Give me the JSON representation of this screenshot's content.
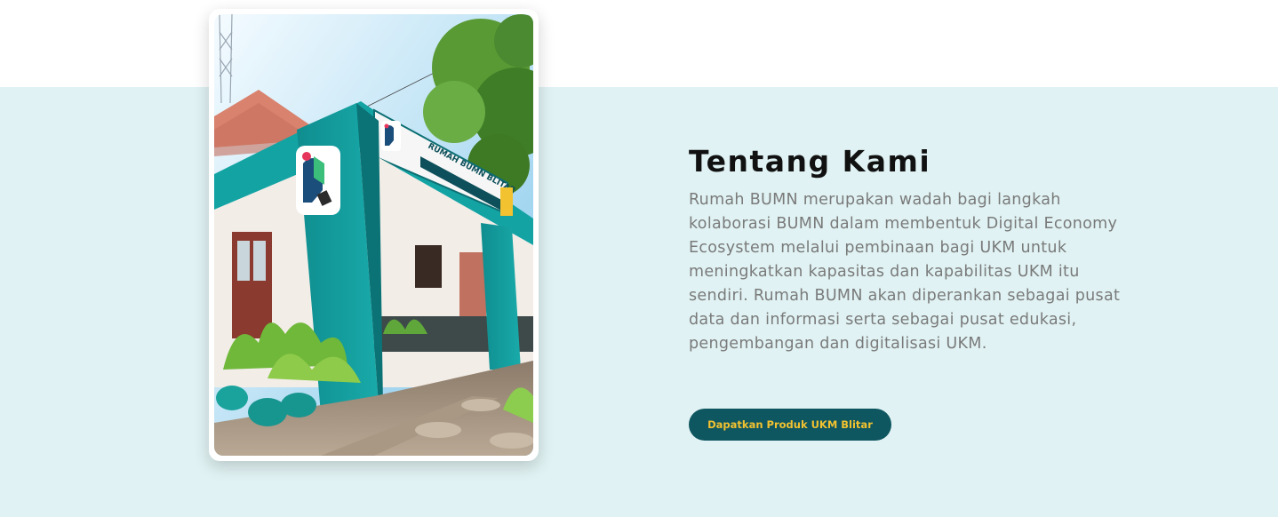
{
  "about": {
    "title": "Tentang Kami",
    "description": "Rumah BUMN merupakan wadah bagi langkah kolaborasi BUMN dalam membentuk Digital Economy Ecosystem melalui pembinaan bagi UKM untuk meningkatkan kapasitas dan kapabilitas UKM itu sendiri. Rumah BUMN akan diperankan sebagai pusat data dan informasi serta sebagai pusat edukasi, pengembangan dan digitalisasi UKM.",
    "cta_label": "Dapatkan Produk UKM Blitar",
    "photo_sign": {
      "line1": "RUMAH BUMN BLITAR"
    }
  },
  "colors": {
    "band_bg": "#e0f2f3",
    "button_bg": "#0e5660",
    "button_text": "#f2c230",
    "building_teal": "#14a3a3"
  }
}
